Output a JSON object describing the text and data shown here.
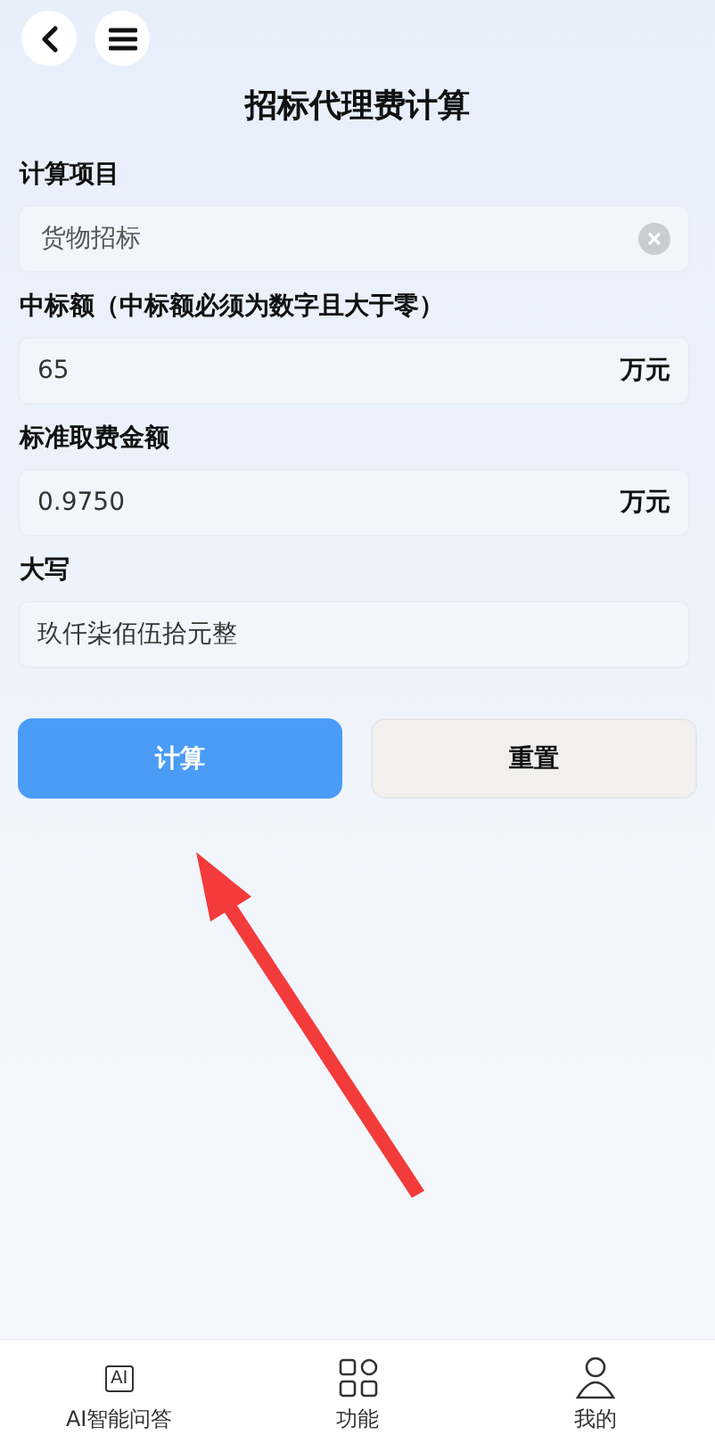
{
  "header": {
    "title": "招标代理费计算"
  },
  "fields": [
    {
      "label": "计算项目",
      "value": "货物招标",
      "clearable": true
    },
    {
      "label": "中标额（中标额必须为数字且大于零）",
      "value": "65",
      "unit": "万元",
      "clearable": false
    },
    {
      "label": "标准取费金额",
      "value": "0.9750",
      "unit": "万元",
      "clearable": false
    },
    {
      "label": "大写",
      "value": "玖仟柒佰伍拾元整",
      "clearable": false
    }
  ],
  "buttons": [
    {
      "label": "计算",
      "kind": "primary"
    },
    {
      "label": "重置",
      "kind": "secondary"
    }
  ],
  "tab_bar": [
    {
      "label": "AI智能问答",
      "kind": "ai",
      "icon_text": "AI",
      "selected": false
    },
    {
      "label": "功能",
      "kind": "grid",
      "selected": false
    },
    {
      "label": "我的",
      "kind": "person",
      "selected": false
    }
  ]
}
